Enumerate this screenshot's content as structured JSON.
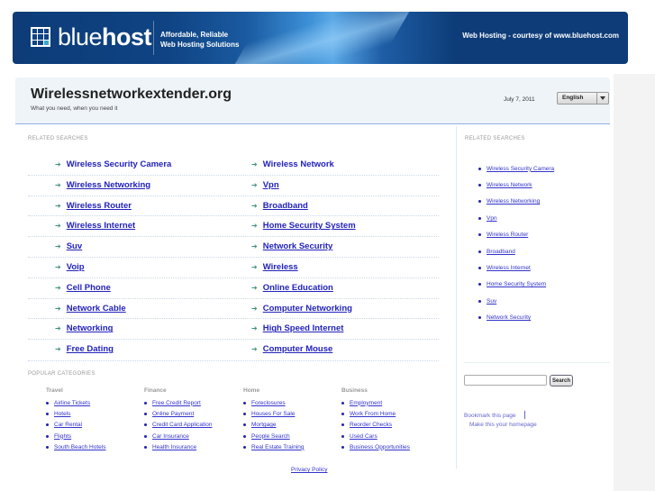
{
  "banner": {
    "logo_text_light": "blue",
    "logo_text_bold": "host",
    "tagline_line1": "Affordable, Reliable",
    "tagline_line2": "Web Hosting Solutions",
    "courtesy": "Web Hosting - courtesy of www.bluehost.com",
    "colors": {
      "background": "#0f4383",
      "highlight": "#3aa8c9"
    }
  },
  "header": {
    "title": "Wirelessnetworkextender.org",
    "subtitle": "What you need, when you need it",
    "date": "July 7, 2011",
    "language": "English"
  },
  "main": {
    "section_label": "RELATED SEARCHES",
    "rows": [
      [
        "Wireless Security Camera",
        "Wireless Network"
      ],
      [
        "Wireless Networking",
        "Vpn"
      ],
      [
        "Wireless Router",
        "Broadband"
      ],
      [
        "Wireless Internet",
        "Home Security System"
      ],
      [
        "Suv",
        "Network Security"
      ],
      [
        "Voip",
        "Wireless"
      ],
      [
        "Cell Phone",
        "Online Education"
      ],
      [
        "Network Cable",
        "Computer Networking"
      ],
      [
        "Networking",
        "High Speed Internet"
      ],
      [
        "Free Dating",
        "Computer Mouse"
      ]
    ]
  },
  "sidebar": {
    "section_label": "RELATED SEARCHES",
    "items": [
      "Wireless Security Camera",
      "Wireless Network",
      "Wireless Networking",
      "Vpn",
      "Wireless Router",
      "Broadband",
      "Wireless Internet",
      "Home Security System",
      "Suv",
      "Network Security"
    ],
    "search_button": "Search",
    "search_value": "",
    "bookmark": "Bookmark this page",
    "homepage": "Make this your homepage"
  },
  "categories": {
    "section_label": "POPULAR CATEGORIES",
    "groups": [
      {
        "title": "Travel",
        "items": [
          "Airline Tickets",
          "Hotels",
          "Car Rental",
          "Flights",
          "South Beach Hotels"
        ]
      },
      {
        "title": "Finance",
        "items": [
          "Free Credit Report",
          "Online Payment",
          "Credit Card Application",
          "Car Insurance",
          "Health Insurance"
        ]
      },
      {
        "title": "Home",
        "items": [
          "Foreclosures",
          "Houses For Sale",
          "Mortgage",
          "People Search",
          "Real Estate Training"
        ]
      },
      {
        "title": "Business",
        "items": [
          "Employment",
          "Work From Home",
          "Reorder Checks",
          "Used Cars",
          "Business Opportunities"
        ]
      }
    ]
  },
  "footer": {
    "privacy": "Privacy Policy"
  }
}
